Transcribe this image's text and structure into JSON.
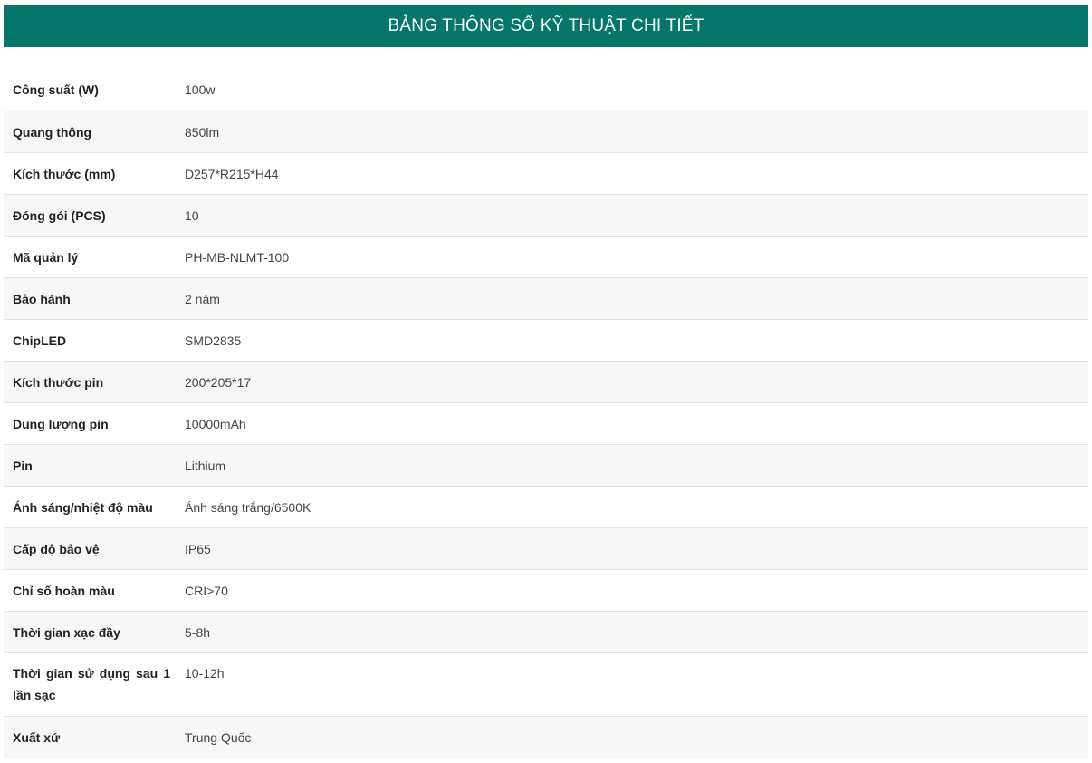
{
  "title": "BẢNG THÔNG SỐ KỸ THUẬT CHI TIẾT",
  "rows": [
    {
      "label": "Công suất (W)",
      "value": "100w"
    },
    {
      "label": "Quang thông",
      "value": "850lm"
    },
    {
      "label": "Kích thước (mm)",
      "value": "D257*R215*H44"
    },
    {
      "label": "Đóng gói (PCS)",
      "value": "10"
    },
    {
      "label": "Mã quản lý",
      "value": "PH-MB-NLMT-100"
    },
    {
      "label": "Bảo hành",
      "value": "2 năm"
    },
    {
      "label": "ChipLED",
      "value": "SMD2835"
    },
    {
      "label": "Kích thước pin",
      "value": "200*205*17"
    },
    {
      "label": "Dung lượng pin",
      "value": "10000mAh"
    },
    {
      "label": "Pin",
      "value": "Lithium"
    },
    {
      "label": "Ánh sáng/nhiệt độ màu",
      "value": "Ánh sáng trắng/6500K"
    },
    {
      "label": "Cấp độ bảo vệ",
      "value": "IP65"
    },
    {
      "label": "Chỉ số hoàn màu",
      "value": "CRI>70"
    },
    {
      "label": "Thời gian xạc đầy",
      "value": "5-8h"
    },
    {
      "label": "Thời gian sử dụng sau 1 lần sạc",
      "value": "10-12h"
    },
    {
      "label": "Xuất xứ",
      "value": "Trung Quốc"
    }
  ]
}
